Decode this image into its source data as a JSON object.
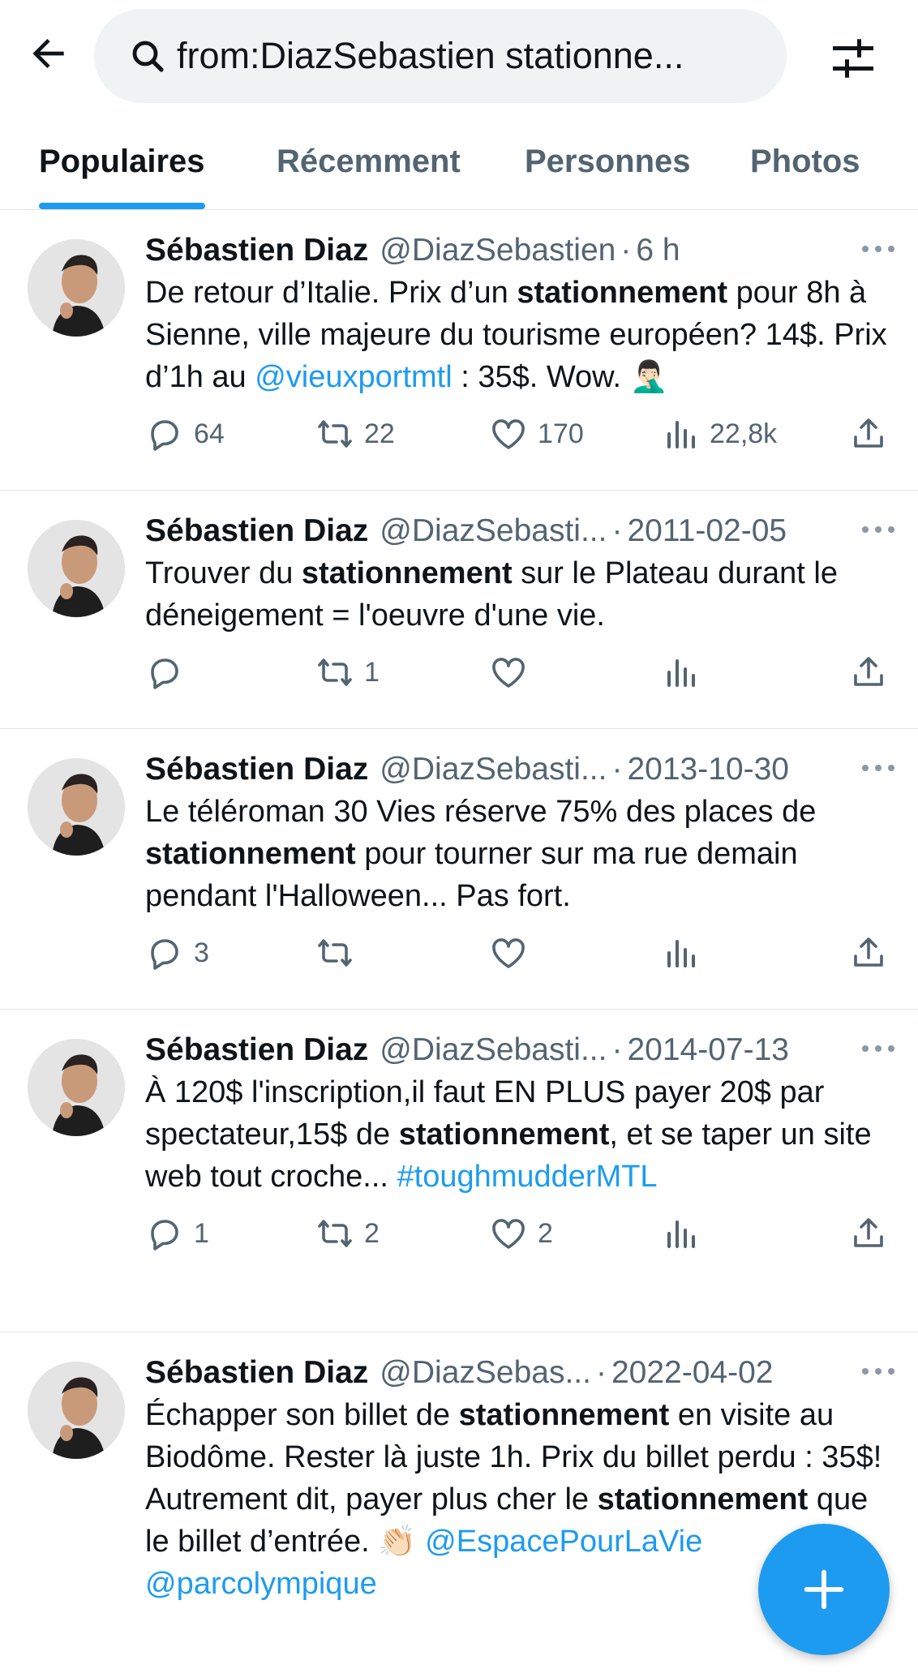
{
  "search": {
    "query": "from:DiazSebastien stationne..."
  },
  "tabs": [
    {
      "label": "Populaires"
    },
    {
      "label": "Récemment"
    },
    {
      "label": "Personnes"
    },
    {
      "label": "Photos"
    }
  ],
  "colors": {
    "accent": "#1d9bf0",
    "text": "#0f1419",
    "muted": "#536471"
  },
  "tweets": [
    {
      "name": "Sébastien Diaz",
      "handle": "@DiazSebastien",
      "time": "6 h",
      "segments": [
        {
          "t": "De retour d’Italie. Prix d’un "
        },
        {
          "t": "stationnement",
          "style": "bold"
        },
        {
          "t": " pour 8h à Sienne, ville majeure du tourisme européen? 14$. Prix d’1h au "
        },
        {
          "t": "@vieuxportmtl",
          "style": "link"
        },
        {
          "t": " : 35$. Wow. 🤦🏻‍♂️"
        }
      ],
      "replies": "64",
      "reposts": "22",
      "likes": "170",
      "views": "22,8k"
    },
    {
      "name": "Sébastien Diaz",
      "handle": "@DiazSebasti...",
      "time": "2011-02-05",
      "segments": [
        {
          "t": "Trouver du "
        },
        {
          "t": "stationnement",
          "style": "bold"
        },
        {
          "t": " sur le Plateau durant le déneigement = l'oeuvre d'une vie."
        }
      ],
      "replies": "",
      "reposts": "1",
      "likes": "",
      "views": ""
    },
    {
      "name": "Sébastien Diaz",
      "handle": "@DiazSebasti...",
      "time": "2013-10-30",
      "segments": [
        {
          "t": "Le téléroman 30 Vies réserve 75% des places de "
        },
        {
          "t": "stationnement",
          "style": "bold"
        },
        {
          "t": " pour tourner sur ma rue demain pendant l'Halloween...  Pas fort."
        }
      ],
      "replies": "3",
      "reposts": "",
      "likes": "",
      "views": ""
    },
    {
      "name": "Sébastien Diaz",
      "handle": "@DiazSebasti...",
      "time": "2014-07-13",
      "segments": [
        {
          "t": "À 120$ l'inscription,il faut EN PLUS payer 20$ par spectateur,15$ de "
        },
        {
          "t": "stationnement",
          "style": "bold"
        },
        {
          "t": ", et se taper un site web tout croche... "
        },
        {
          "t": "#toughmudderMTL",
          "style": "link"
        }
      ],
      "replies": "1",
      "reposts": "2",
      "likes": "2",
      "views": ""
    },
    {
      "name": "Sébastien Diaz",
      "handle": "@DiazSebas...",
      "time": "2022-04-02",
      "segments": [
        {
          "t": "Échapper son billet de "
        },
        {
          "t": "stationnement",
          "style": "bold"
        },
        {
          "t": " en visite au Biodôme. Rester là juste 1h. Prix du billet perdu : 35$! Autrement dit, payer plus cher le "
        },
        {
          "t": "stationnement",
          "style": "bold"
        },
        {
          "t": " que le billet d’entrée. 👏🏻 "
        },
        {
          "t": "@EspacePourLaVie",
          "style": "link"
        },
        {
          "t": " "
        },
        {
          "t": "@parcolympique",
          "style": "link"
        }
      ],
      "replies": "",
      "reposts": "",
      "likes": "",
      "views": ""
    }
  ]
}
